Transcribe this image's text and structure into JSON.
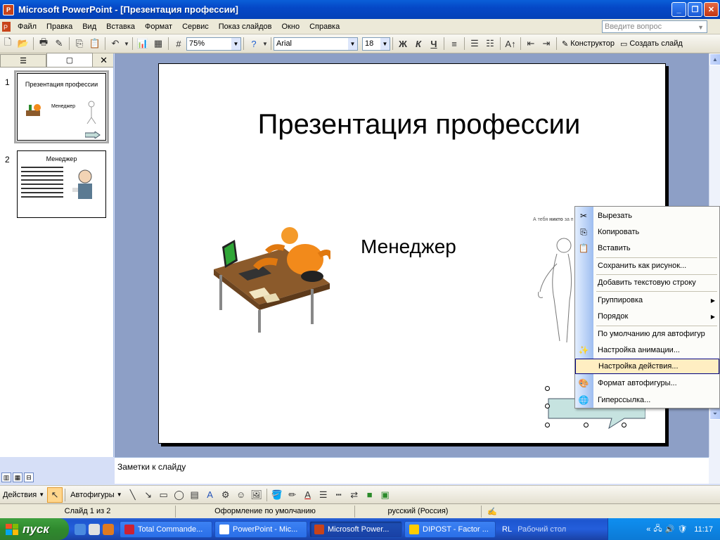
{
  "window": {
    "title": "Microsoft PowerPoint - [Презентация профессии]",
    "app_icon": "P"
  },
  "menubar": {
    "items": [
      "Файл",
      "Правка",
      "Вид",
      "Вставка",
      "Формат",
      "Сервис",
      "Показ слайдов",
      "Окно",
      "Справка"
    ],
    "ask_placeholder": "Введите вопрос"
  },
  "toolbar": {
    "zoom": "75%",
    "font": "Arial",
    "size": "18",
    "bold": "Ж",
    "italic": "К",
    "underline": "Ч",
    "designer": "Конструктор",
    "new_slide": "Создать слайд"
  },
  "thumbnails": [
    {
      "num": "1",
      "title": "Презентация профессии",
      "sub": "Менеджер"
    },
    {
      "num": "2",
      "title": "Менеджер"
    }
  ],
  "slide": {
    "title": "Презентация профессии",
    "subtitle": "Менеджер",
    "caption_prefix": "А тебя ",
    "caption_bold": "никто",
    "caption_rest": " за п"
  },
  "context_menu": {
    "items": [
      {
        "label": "Вырезать",
        "icon": "scissors-icon"
      },
      {
        "label": "Копировать",
        "icon": "copy-icon"
      },
      {
        "label": "Вставить",
        "icon": "paste-icon"
      },
      {
        "label": "Сохранить как рисунок...",
        "icon": ""
      },
      {
        "label": "Добавить текстовую строку",
        "icon": ""
      },
      {
        "label": "Группировка",
        "icon": "",
        "submenu": true
      },
      {
        "label": "Порядок",
        "icon": "",
        "submenu": true
      },
      {
        "label": "По умолчанию для автофигур",
        "icon": ""
      },
      {
        "label": "Настройка анимации...",
        "icon": "animation-icon"
      },
      {
        "label": "Настройка действия...",
        "icon": "",
        "highlighted": true
      },
      {
        "label": "Формат автофигуры...",
        "icon": "format-icon"
      },
      {
        "label": "Гиперссылка...",
        "icon": "hyperlink-icon"
      }
    ]
  },
  "notes": {
    "placeholder": "Заметки к слайду"
  },
  "drawing": {
    "actions": "Действия",
    "autoshapes": "Автофигуры"
  },
  "status": {
    "slide": "Слайд 1 из 2",
    "design": "Оформление по умолчанию",
    "language": "русский (Россия)"
  },
  "taskbar": {
    "start": "пуск",
    "tasks": [
      "Total Commande...",
      "PowerPoint - Mic...",
      "Microsoft Power...",
      "DIPOST - Factor ..."
    ],
    "desktop": "Рабочий стол",
    "lang": "RL",
    "clock": "11:17"
  },
  "colors": {
    "accent": "#0a5fd8",
    "menu_highlight": "#ffeec2",
    "workarea": "#8d9fc6"
  }
}
